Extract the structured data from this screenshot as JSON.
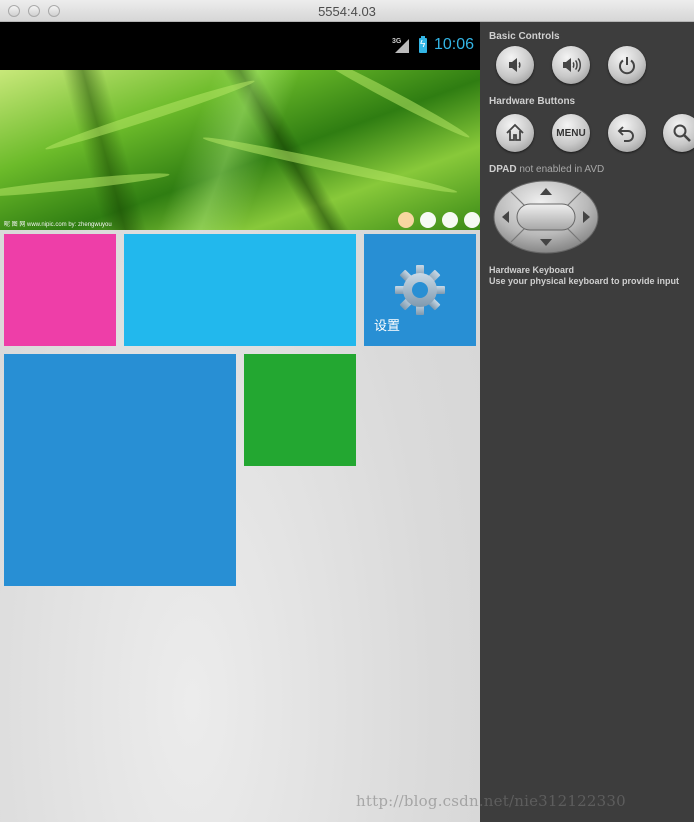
{
  "window": {
    "title": "5554:4.03"
  },
  "statusbar": {
    "network": "3G",
    "time": "10:06"
  },
  "banner": {
    "caption": "昵 图 网 www.nipic.com    by: zhengwuyou",
    "dots": 4,
    "active_dot": 0
  },
  "tiles": {
    "settings_label": "设置"
  },
  "panel": {
    "basic_controls": "Basic Controls",
    "hardware_buttons": "Hardware Buttons",
    "menu_label": "MENU",
    "dpad_strong": "DPAD",
    "dpad_rest": " not enabled in AVD",
    "keyboard_title": "Hardware Keyboard",
    "keyboard_hint": "Use your physical keyboard to provide input"
  },
  "watermark": "http://blog.csdn.net/nie312122330",
  "colors": {
    "pink": "#ee3ea8",
    "cyan": "#22b8ed",
    "blue": "#288fd4",
    "green": "#23a731",
    "accent": "#33b5e5"
  }
}
